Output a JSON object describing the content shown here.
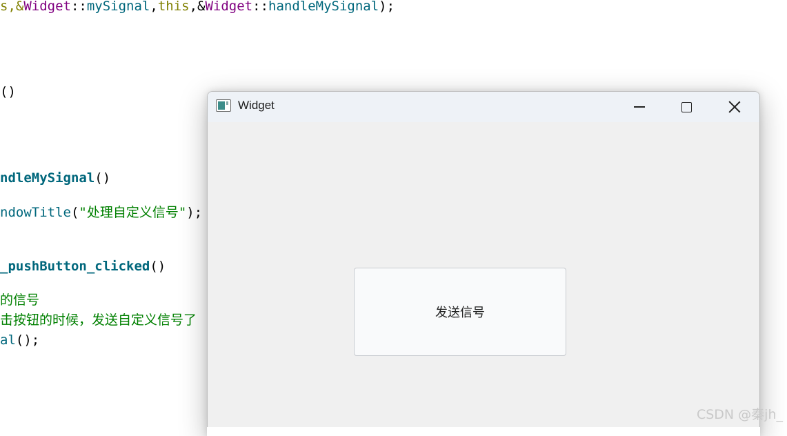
{
  "colors": {
    "keyword": "#808000",
    "class": "#800080",
    "method": "#00677c",
    "string": "#008000",
    "comment": "#008000",
    "plain": "#000000"
  },
  "code_lines": [
    [
      {
        "t": "s,&",
        "c": "#808000"
      },
      {
        "t": "Widget",
        "c": "#800080"
      },
      {
        "t": "::",
        "c": "#000000"
      },
      {
        "t": "mySignal",
        "c": "#00677c"
      },
      {
        "t": ",",
        "c": "#000000"
      },
      {
        "t": "this",
        "c": "#808000"
      },
      {
        "t": ",&",
        "c": "#000000"
      },
      {
        "t": "Widget",
        "c": "#800080"
      },
      {
        "t": "::",
        "c": "#000000"
      },
      {
        "t": "handleMySignal",
        "c": "#00677c"
      },
      {
        "t": ");",
        "c": "#000000"
      }
    ],
    [
      {
        "t": "()",
        "c": "#000000"
      }
    ],
    [
      {
        "t": "ndleMySignal",
        "c": "#00677c",
        "b": true
      },
      {
        "t": "()",
        "c": "#000000"
      }
    ],
    [
      {
        "t": "ndowTitle",
        "c": "#00677c"
      },
      {
        "t": "(",
        "c": "#000000"
      },
      {
        "t": "\"处理自定义信号\"",
        "c": "#008000"
      },
      {
        "t": ");",
        "c": "#000000"
      }
    ],
    [
      {
        "t": "_pushButton_clicked",
        "c": "#00677c",
        "b": true
      },
      {
        "t": "()",
        "c": "#000000"
      }
    ],
    [
      {
        "t": "的信号",
        "c": "#008000"
      }
    ],
    [
      {
        "t": "击按钮的时候，发送自定义信号了",
        "c": "#008000"
      }
    ],
    [
      {
        "t": "al",
        "c": "#00677c"
      },
      {
        "t": "();",
        "c": "#000000"
      }
    ]
  ],
  "window": {
    "title": "Widget",
    "button_label": "发送信号"
  },
  "watermark": "CSDN @秦jh_"
}
